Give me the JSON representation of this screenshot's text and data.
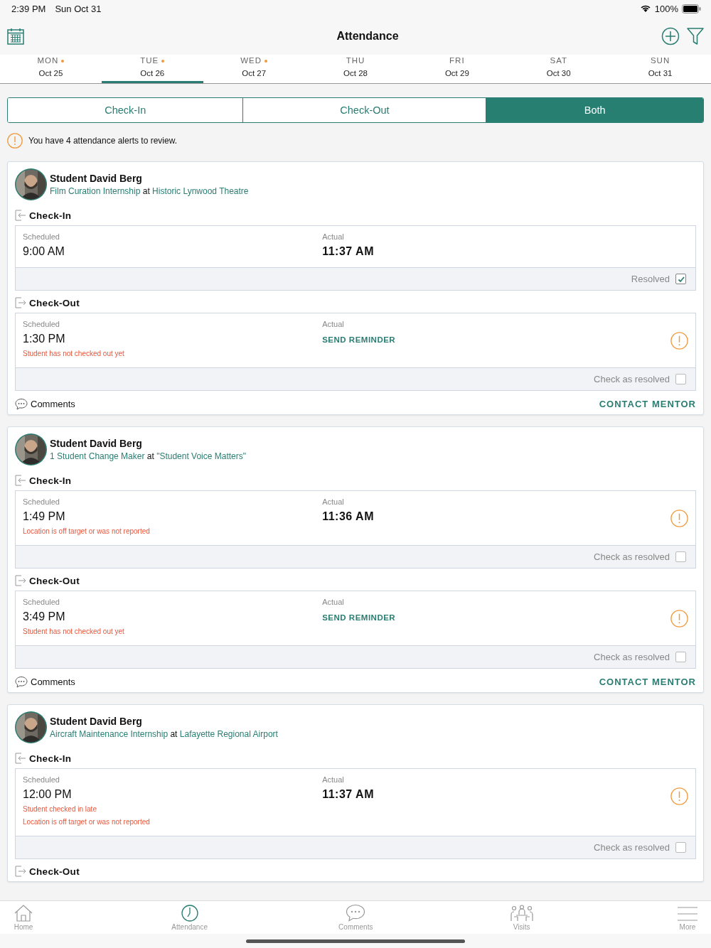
{
  "status_bar": {
    "time": "2:39 PM",
    "date": "Sun Oct 31",
    "battery": "100%"
  },
  "nav": {
    "title": "Attendance"
  },
  "days": [
    {
      "weekday": "MON",
      "date": "Oct 25",
      "selected": false,
      "alert": true
    },
    {
      "weekday": "TUE",
      "date": "Oct 26",
      "selected": true,
      "alert": true
    },
    {
      "weekday": "WED",
      "date": "Oct 27",
      "selected": false,
      "alert": true
    },
    {
      "weekday": "THU",
      "date": "Oct 28",
      "selected": false,
      "alert": false
    },
    {
      "weekday": "FRI",
      "date": "Oct 29",
      "selected": false,
      "alert": false
    },
    {
      "weekday": "SAT",
      "date": "Oct 30",
      "selected": false,
      "alert": false
    },
    {
      "weekday": "SUN",
      "date": "Oct 31",
      "selected": false,
      "alert": false
    }
  ],
  "segments": [
    {
      "label": "Check-In",
      "selected": false
    },
    {
      "label": "Check-Out",
      "selected": false
    },
    {
      "label": "Both",
      "selected": true
    }
  ],
  "alert_message": "You have 4 attendance alerts to review.",
  "cards": [
    {
      "student": "Student David Berg",
      "program": "Film Curation Internship",
      "connector": "at",
      "site": "Historic Lynwood Theatre",
      "sections": [
        {
          "kind": "check-in",
          "title": "Check-In",
          "scheduled_label": "Scheduled",
          "scheduled": "9:00 AM",
          "actual_label": "Actual",
          "actual": "11:37 AM",
          "warning": false,
          "resolve_label": "Resolved",
          "resolved": true
        },
        {
          "kind": "check-out",
          "title": "Check-Out",
          "scheduled_label": "Scheduled",
          "scheduled": "1:30 PM",
          "actual_label": "Actual",
          "action": "SEND REMINDER",
          "warning": true,
          "messages": [
            "Student has not checked out yet"
          ],
          "resolve_label": "Check as resolved",
          "resolved": false
        }
      ],
      "comments_label": "Comments",
      "contact_label": "CONTACT MENTOR"
    },
    {
      "student": "Student David Berg",
      "program": "1 Student Change Maker",
      "connector": "at",
      "site": "\"Student Voice Matters\"",
      "sections": [
        {
          "kind": "check-in",
          "title": "Check-In",
          "scheduled_label": "Scheduled",
          "scheduled": "1:49 PM",
          "actual_label": "Actual",
          "actual": "11:36 AM",
          "warning": true,
          "messages": [
            "Location is off target or was not reported"
          ],
          "resolve_label": "Check as resolved",
          "resolved": false
        },
        {
          "kind": "check-out",
          "title": "Check-Out",
          "scheduled_label": "Scheduled",
          "scheduled": "3:49 PM",
          "actual_label": "Actual",
          "action": "SEND REMINDER",
          "warning": true,
          "messages": [
            "Student has not checked out yet"
          ],
          "resolve_label": "Check as resolved",
          "resolved": false
        }
      ],
      "comments_label": "Comments",
      "contact_label": "CONTACT MENTOR"
    },
    {
      "student": "Student David Berg",
      "program": "Aircraft Maintenance Internship",
      "connector": "at",
      "site": "Lafayette Regional Airport",
      "sections": [
        {
          "kind": "check-in",
          "title": "Check-In",
          "scheduled_label": "Scheduled",
          "scheduled": "12:00 PM",
          "actual_label": "Actual",
          "actual": "11:37 AM",
          "warning": true,
          "messages": [
            "Student checked in late",
            "Location is off target or was not reported"
          ],
          "resolve_label": "Check as resolved",
          "resolved": false
        },
        {
          "kind": "check-out",
          "title": "Check-Out"
        }
      ]
    }
  ],
  "tab_bar": [
    {
      "kind": "home",
      "label": "Home",
      "selected": false
    },
    {
      "kind": "attendance",
      "label": "Attendance",
      "selected": true
    },
    {
      "kind": "comments",
      "label": "Comments",
      "selected": false
    },
    {
      "kind": "visits",
      "label": "Visits",
      "selected": false
    },
    {
      "kind": "more",
      "label": "More",
      "selected": false
    }
  ]
}
